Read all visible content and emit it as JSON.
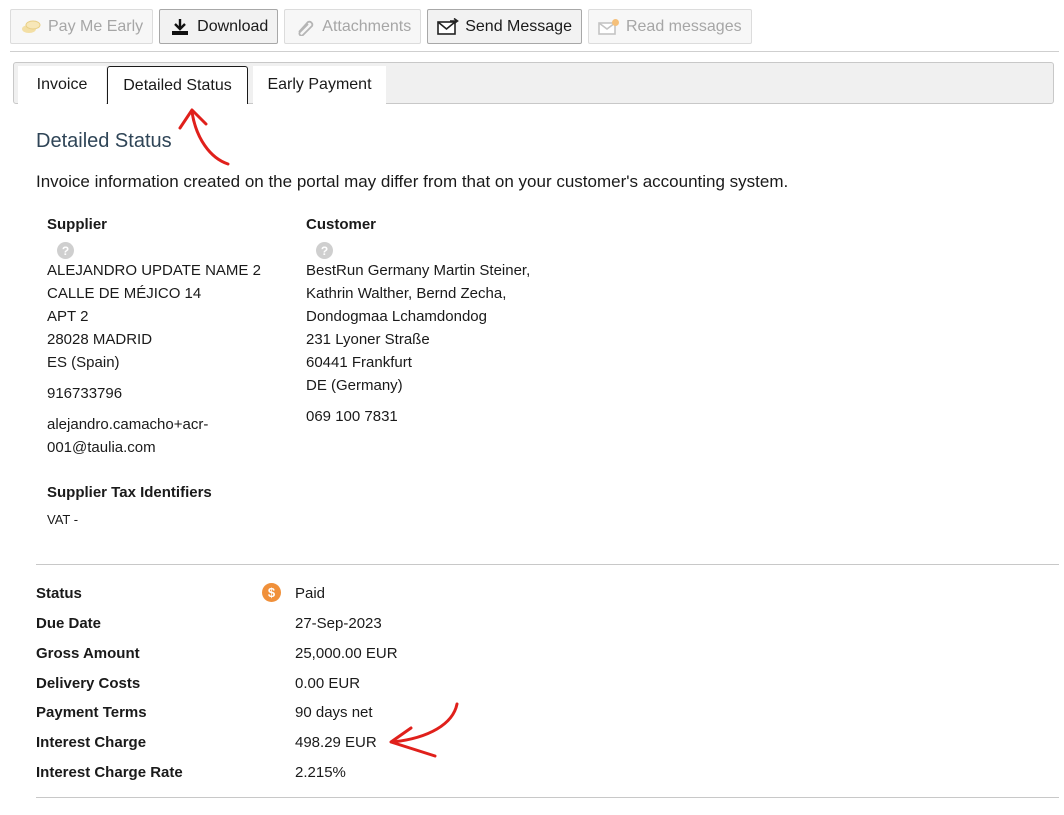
{
  "toolbar": {
    "pay_me_early": "Pay Me Early",
    "download": "Download",
    "attachments": "Attachments",
    "send_message": "Send Message",
    "read_messages": "Read messages"
  },
  "tabs": [
    {
      "label": "Invoice"
    },
    {
      "label": "Detailed Status"
    },
    {
      "label": "Early Payment"
    }
  ],
  "page": {
    "title": "Detailed Status",
    "notice": "Invoice information created on the portal may differ from that on your customer's accounting system."
  },
  "supplier": {
    "heading": "Supplier",
    "address": [
      "ALEJANDRO UPDATE NAME 2",
      "CALLE DE MÉJICO 14",
      "APT 2",
      "28028 MADRID",
      "ES (Spain)"
    ],
    "phone": "916733796",
    "email_lines": [
      "alejandro.camacho+acr-",
      "001@taulia.com"
    ],
    "tax_heading": "Supplier Tax Identifiers",
    "tax_value": "VAT -"
  },
  "customer": {
    "heading": "Customer",
    "address": [
      "BestRun Germany Martin Steiner,",
      "Kathrin Walther, Bernd Zecha,",
      "Dondogmaa Lchamdondog",
      "231 Lyoner Straße",
      "60441 Frankfurt",
      "DE (Germany)"
    ],
    "phone": "069 100 7831"
  },
  "details": [
    {
      "label": "Status",
      "value": "Paid"
    },
    {
      "label": "Due Date",
      "value": "27-Sep-2023"
    },
    {
      "label": "Gross Amount",
      "value": "25,000.00 EUR"
    },
    {
      "label": "Delivery Costs",
      "value": "0.00 EUR"
    },
    {
      "label": "Payment Terms",
      "value": "90 days net"
    },
    {
      "label": "Interest Charge",
      "value": "498.29 EUR"
    },
    {
      "label": "Interest Charge Rate",
      "value": "2.215%"
    }
  ],
  "icons": {
    "help": "?",
    "status_paid": "$"
  },
  "colors": {
    "title": "#2f4557",
    "status_icon": "#f0903a",
    "annotation_arrow": "#e0201b"
  }
}
